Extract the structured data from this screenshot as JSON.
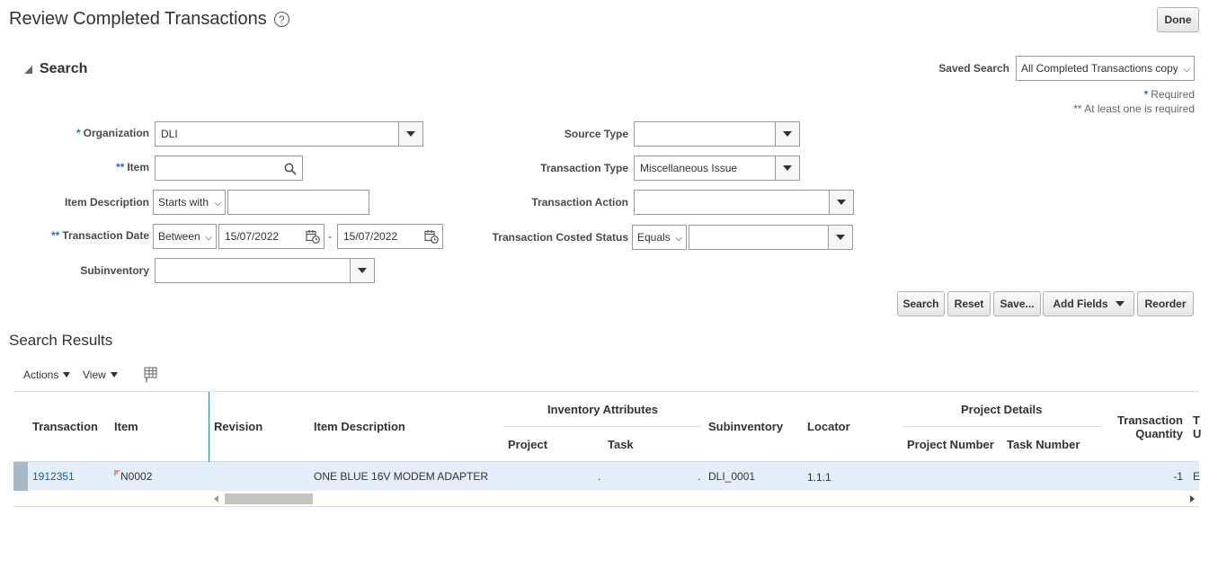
{
  "page": {
    "title": "Review Completed Transactions",
    "done_label": "Done"
  },
  "search": {
    "section_title": "Search",
    "saved_search_label": "Saved Search",
    "saved_search_value": "All Completed Transactions copy",
    "required_note": "Required",
    "required_star": "*",
    "at_least_one_note": "** At least one is required",
    "fields": {
      "organization": {
        "marker": "*",
        "label": "Organization",
        "value": "DLI"
      },
      "item": {
        "marker": "**",
        "label": "Item",
        "value": ""
      },
      "item_description": {
        "label": "Item Description",
        "operator": "Starts with",
        "value": ""
      },
      "transaction_date": {
        "marker": "**",
        "label": "Transaction Date",
        "operator": "Between",
        "from": "15/07/2022",
        "dash": "-",
        "to": "15/07/2022"
      },
      "subinventory": {
        "label": "Subinventory",
        "value": ""
      },
      "source_type": {
        "label": "Source Type",
        "value": ""
      },
      "transaction_type": {
        "label": "Transaction Type",
        "value": "Miscellaneous Issue"
      },
      "transaction_action": {
        "label": "Transaction Action",
        "value": ""
      },
      "transaction_costed_status": {
        "label": "Transaction Costed Status",
        "operator": "Equals",
        "value": ""
      }
    },
    "buttons": {
      "search": "Search",
      "reset": "Reset",
      "save": "Save...",
      "add_fields": "Add Fields",
      "reorder": "Reorder"
    }
  },
  "results": {
    "title": "Search Results",
    "toolbar": {
      "actions": "Actions",
      "view": "View"
    },
    "groups": {
      "inventory_attributes": "Inventory Attributes",
      "project_details": "Project Details"
    },
    "columns": {
      "transaction": "Transaction",
      "item": "Item",
      "revision": "Revision",
      "item_description": "Item Description",
      "project": "Project",
      "task": "Task",
      "subinventory": "Subinventory",
      "locator": "Locator",
      "project_number": "Project Number",
      "task_number": "Task Number",
      "transaction_quantity_1": "Transaction",
      "transaction_quantity_2": "Quantity",
      "next_col_1": "T",
      "next_col_2": "U"
    },
    "rows": [
      {
        "transaction": "1912351",
        "item": "N0002",
        "revision": "",
        "item_description": "ONE BLUE 16V MODEM ADAPTER",
        "project": ".",
        "task": ".",
        "subinventory": "DLI_0001",
        "locator": "1.1.1",
        "quantity": "-1",
        "next": "E"
      }
    ]
  }
}
